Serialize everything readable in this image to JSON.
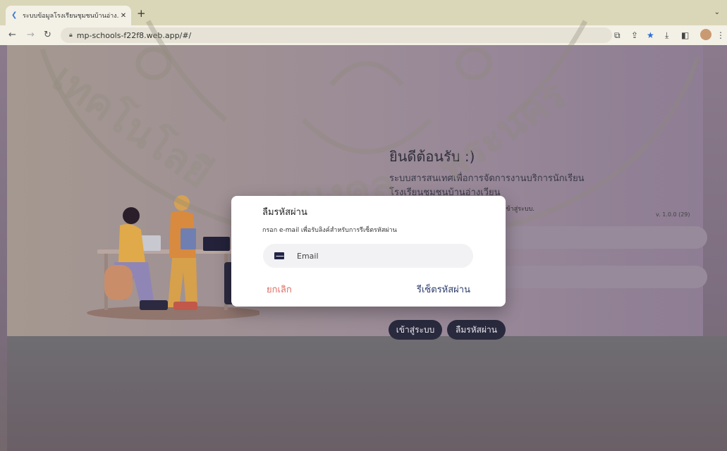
{
  "browser": {
    "tab_title": "ระบบข้อมูลโรงเรียนชุมชนบ้านอ่าง...",
    "new_tab": "+",
    "url": "mp-schools-f22f8.web.app/#/"
  },
  "page": {
    "welcome": "ยินดีต้อนรับ :)",
    "subtitle_line1": "ระบบสารสนเทศเพื่อการจัดการงานบริการนักเรียน",
    "subtitle_line2": "โรงเรียนชุมชนบ้านอ่างเวียน",
    "hint": "เพื่อเข้าสู่ระบบ.",
    "version": "v. 1.0.0 (29)",
    "login_button": "เข้าสู่ระบบ",
    "forgot_button": "ลืมรหัสผ่าน"
  },
  "dialog": {
    "title": "ลืมรหัสผ่าน",
    "subtitle": "กรอก e-mail เพื่อรับลิงค์สำหรับการรีเซ็ตรหัสผ่าน",
    "email_placeholder": "Email",
    "cancel": "ยกเลิก",
    "reset": "รีเซ็ตรหัสผ่าน"
  },
  "colors": {
    "cancel": "#e06b62",
    "reset": "#2a3b6a",
    "page_button": "#2a2a3e"
  }
}
